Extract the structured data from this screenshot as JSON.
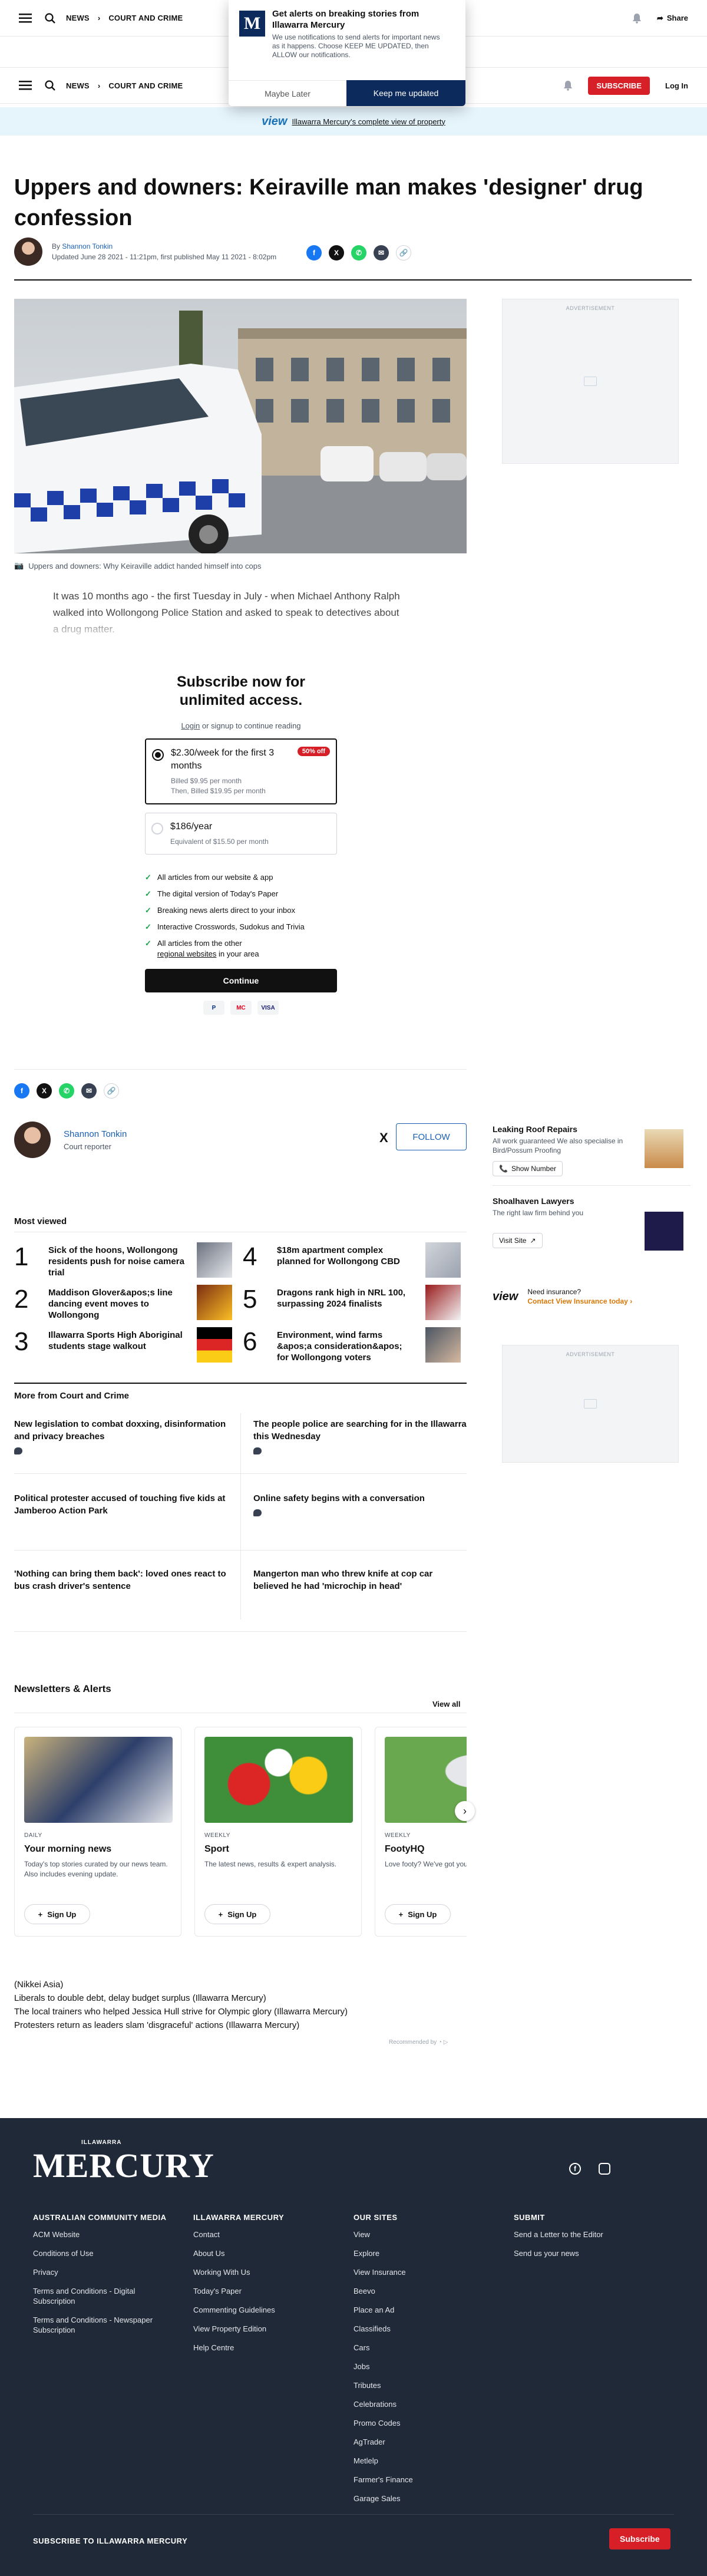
{
  "header": {
    "breadcrumb": [
      "NEWS",
      "COURT AND CRIME"
    ],
    "share_label": "Share",
    "subscribe_label": "SUBSCRIBE",
    "login_label": "Log In"
  },
  "notification": {
    "logo_letter": "M",
    "title": "Get alerts on breaking stories from Illawarra Mercury",
    "body": "We use notifications to send alerts for important news as it happens. Choose KEEP ME UPDATED, then ALLOW our notifications.",
    "maybe_label": "Maybe Later",
    "keep_label": "Keep me updated"
  },
  "view_strip": {
    "logo": "view",
    "text": "Illawarra Mercury's complete view of property"
  },
  "article": {
    "title": "Uppers and downers: Keiraville man makes 'designer' drug confession",
    "by": "By",
    "author": "Shannon Tonkin",
    "dates": "Updated June 28 2021 - 11:21pm, first published May 11 2021 - 8:02pm",
    "caption": "Uppers and downers: Why Keiraville addict handed himself into cops",
    "lede": "It was 10 months ago - the first Tuesday in July - when Michael Anthony Ralph walked into Wollongong Police Station and asked to speak to detectives about a drug matter."
  },
  "ad_label": "ADVERTISEMENT",
  "paywall": {
    "heading": "Subscribe now for unlimited access.",
    "login_text": "Login",
    "login_rest": " or signup to continue reading",
    "plans": [
      {
        "price": "$2.30/week for the first 3 months",
        "sub1": "Billed $9.95 per month",
        "sub2": "Then, Billed $19.95 per month",
        "badge": "50% off"
      },
      {
        "price": "$186/year",
        "sub1": "Equivalent of $15.50 per month"
      }
    ],
    "features": [
      "All articles from our website & app",
      "The digital version of Today's Paper",
      "Breaking news alerts direct to your inbox",
      "Interactive Crosswords, Sudokus and Trivia"
    ],
    "feature_last_a": "All articles from the other",
    "feature_last_link": "regional websites",
    "feature_last_b": " in your area",
    "continue_label": "Continue",
    "payments": [
      "P",
      "MC",
      "VISA"
    ]
  },
  "author_card": {
    "name": "Shannon Tonkin",
    "role": "Court reporter",
    "follow_label": "FOLLOW"
  },
  "most_viewed": {
    "heading": "Most viewed",
    "items": [
      {
        "num": "1",
        "title": "Sick of the hoons, Wollongong residents push for noise camera trial"
      },
      {
        "num": "2",
        "title": "Maddison Glover&apos;s line dancing event moves to Wollongong"
      },
      {
        "num": "3",
        "title": "Illawarra Sports High Aboriginal students stage walkout"
      },
      {
        "num": "4",
        "title": "$18m apartment complex planned for Wollongong CBD"
      },
      {
        "num": "5",
        "title": "Dragons rank high in NRL 100, surpassing 2024 finalists"
      },
      {
        "num": "6",
        "title": "Environment, wind farms &apos;a consideration&apos; for Wollongong voters"
      }
    ]
  },
  "more_from": {
    "heading": "More from Court and Crime",
    "items": [
      "New legislation to combat doxxing, disinformation and privacy breaches",
      "The people police are searching for in the Illawarra this Wednesday",
      "Political protester accused of touching five kids at Jamberoo Action Park",
      "Online safety begins with a conversation",
      "'Nothing can bring them back': loved ones react to bus crash driver's sentence",
      "Mangerton man who threw knife at cop car believed he had 'microchip in head'"
    ]
  },
  "sponsored": [
    {
      "title": "Leaking Roof Repairs",
      "desc": "All work guaranteed We also specialise in Bird/Possum Proofing",
      "cta": "Show Number"
    },
    {
      "title": "Shoalhaven Lawyers",
      "desc": "The right law firm behind you",
      "cta": "Visit Site"
    }
  ],
  "view_insurance": {
    "logo": "view",
    "q": "Need insurance?",
    "cta": "Contact View Insurance today"
  },
  "newsletters": {
    "heading": "Newsletters & Alerts",
    "view_all": "View all",
    "items": [
      {
        "freq": "DAILY",
        "name": "Your morning news",
        "desc": "Today's top stories curated by our news team. Also includes evening update.",
        "signup": "Sign Up"
      },
      {
        "freq": "WEEKLY",
        "name": "Sport",
        "desc": "The latest news, results & expert analysis.",
        "signup": "Sign Up"
      },
      {
        "freq": "WEEKLY",
        "name": "FootyHQ",
        "desc": "Love footy? We've got you covered.",
        "signup": "Sign Up"
      }
    ]
  },
  "recommended": {
    "items": [
      "(Nikkei Asia)",
      "Liberals to double debt, delay budget surplus (Illawarra Mercury)",
      "The local trainers who helped Jessica Hull strive for Olympic glory (Illawarra Mercury)",
      "Protesters return as leaders slam 'disgraceful' actions (Illawarra Mercury)"
    ],
    "label": "Recommended by"
  },
  "footer": {
    "brand_top": "ILLAWARRA",
    "brand": "MERCURY",
    "columns": [
      {
        "title": "AUSTRALIAN COMMUNITY MEDIA",
        "links": [
          "ACM Website",
          "Conditions of Use",
          "Privacy",
          "Terms and Conditions - Digital Subscription",
          "Terms and Conditions - Newspaper Subscription"
        ]
      },
      {
        "title": "ILLAWARRA MERCURY",
        "links": [
          "Contact",
          "About Us",
          "Working With Us",
          "Today's Paper",
          "Commenting Guidelines",
          "View Property Edition",
          "Help Centre"
        ]
      },
      {
        "title": "OUR SITES",
        "links": [
          "View",
          "Explore",
          "View Insurance",
          "Beevo",
          "Place an Ad",
          "Classifieds",
          "Cars",
          "Jobs",
          "Tributes",
          "Celebrations",
          "Promo Codes",
          "AgTrader",
          "Metlelp",
          "Farmer's Finance",
          "Garage Sales"
        ]
      },
      {
        "title": "SUBMIT",
        "links": [
          "Send a Letter to the Editor",
          "Send us your news"
        ]
      }
    ],
    "subscribe_text": "SUBSCRIBE TO ILLAWARRA MERCURY",
    "subscribe_label": "Subscribe"
  },
  "colors": {
    "brand_red": "#d61f26",
    "navy": "#0d2a5c",
    "link_blue": "#1a5fb4",
    "footer_bg": "#1f2937"
  }
}
